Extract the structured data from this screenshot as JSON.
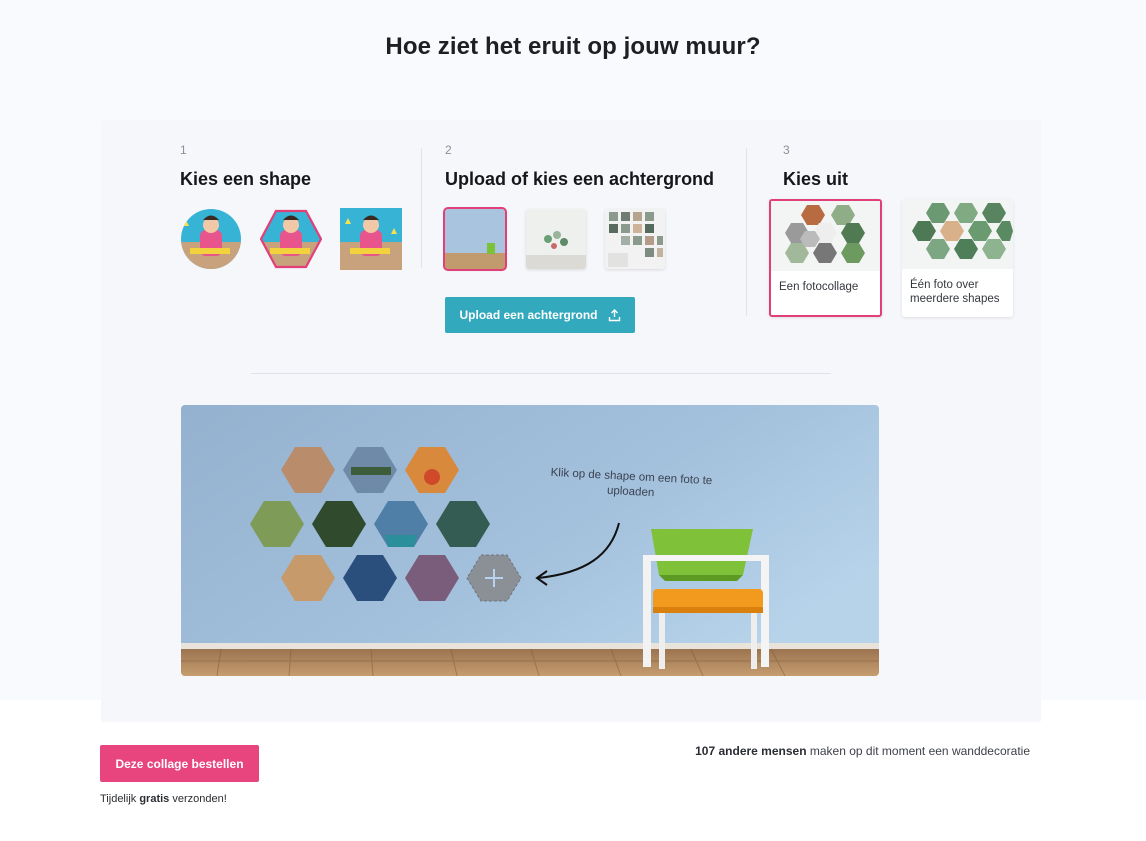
{
  "page": {
    "title": "Hoe ziet het eruit op jouw muur?"
  },
  "steps": [
    {
      "number": "1",
      "title": "Kies een shape"
    },
    {
      "number": "2",
      "title": "Upload of kies een achtergrond"
    },
    {
      "number": "3",
      "title": "Kies uit"
    }
  ],
  "shapes": [
    "circle-shape",
    "hexagon-shape",
    "square-shape"
  ],
  "backgrounds": [
    "blue-wall-background",
    "white-wall-background",
    "photo-wall-background"
  ],
  "upload": {
    "label": "Upload een achtergrond",
    "icon": "upload-icon"
  },
  "options": [
    {
      "label": "Een fotocollage"
    },
    {
      "label": "Één foto over meerdere shapes"
    }
  ],
  "preview": {
    "hint": "Klik op de shape om een foto te uploaden",
    "empty_slot_icon": "plus-icon"
  },
  "footer": {
    "order_label": "Deze collage bestellen",
    "shipping_prefix": "Tijdelijk ",
    "shipping_bold": "gratis",
    "shipping_suffix": " verzonden!",
    "social_bold": "107 andere mensen",
    "social_rest": " maken op dit moment een wanddecoratie"
  },
  "colors": {
    "accent": "#e8447d",
    "teal": "#33a9bd",
    "wall": "#9dbad6",
    "floor": "#b58b60"
  }
}
